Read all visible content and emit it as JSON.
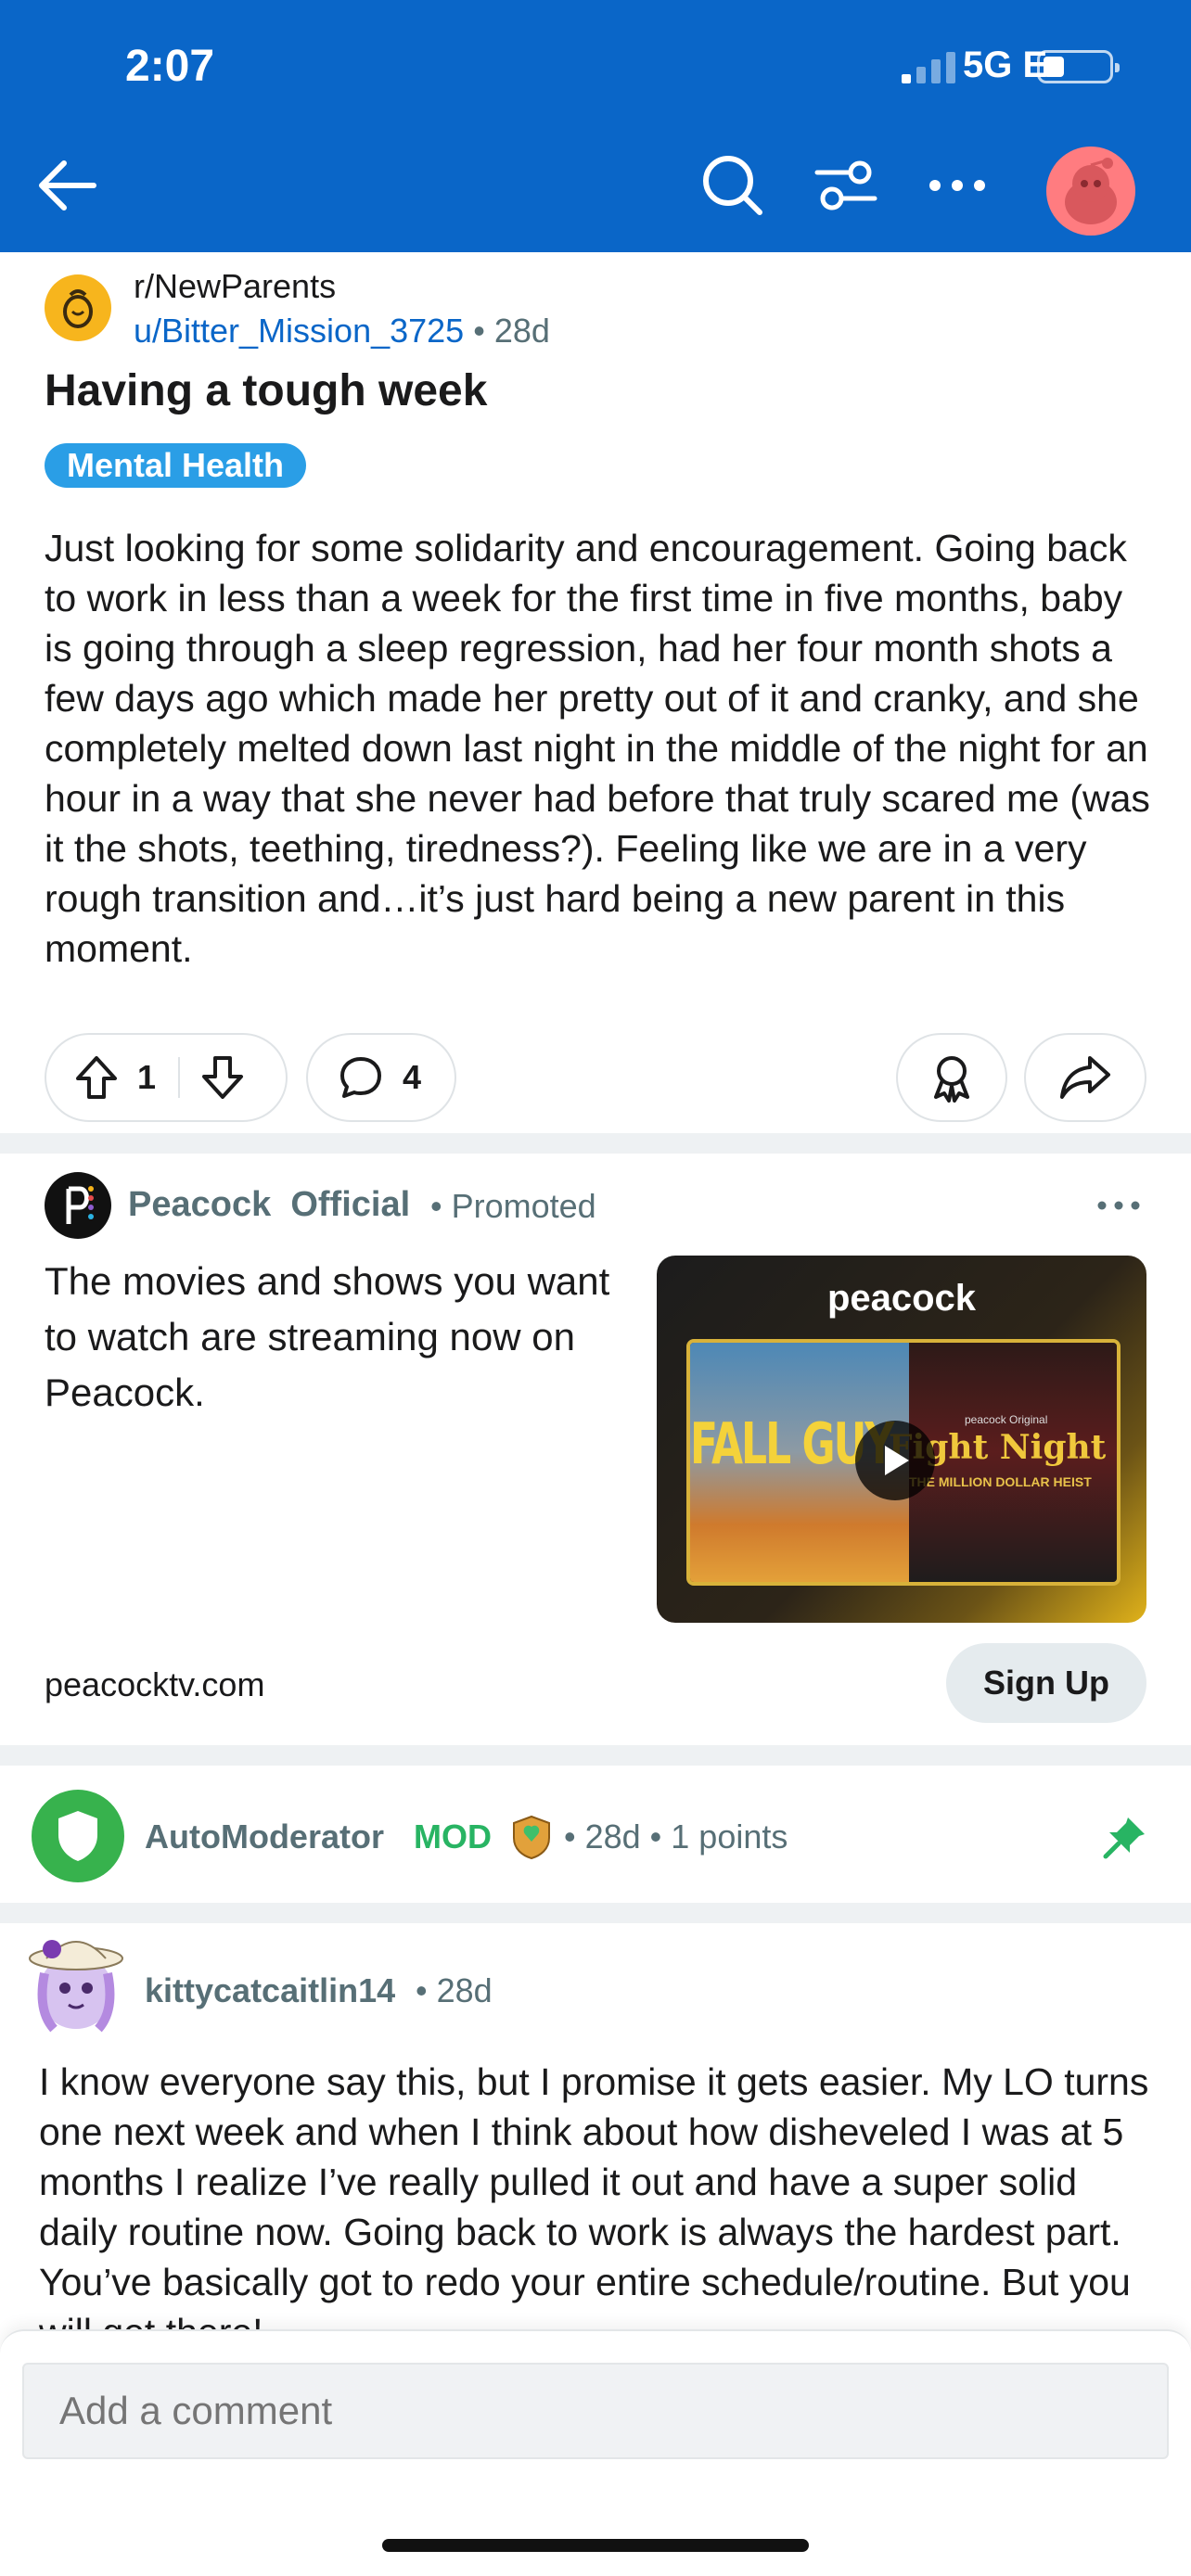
{
  "status_bar": {
    "time": "2:07",
    "network": "5G E"
  },
  "post": {
    "subreddit": "r/NewParents",
    "author": "u/Bitter_Mission_3725",
    "age": "28d",
    "title": "Having a tough week",
    "flair": "Mental Health",
    "body": "Just looking for some solidarity and encouragement. Going back to work in less than a week for the first time in five months, baby is going through a sleep regression, had her four month shots a few days ago which made her pretty out of it and cranky, and she completely melted down last night in the middle of the night for an hour in a way that she never had before that truly scared me (was it the shots, teething, tiredness?). Feeling like we are in a very rough transition and…it’s just hard being a new parent in this moment.",
    "upvotes": "1",
    "comments": "4"
  },
  "ad": {
    "advertiser": "Peacock  Official",
    "promoted": "• Promoted",
    "text": "The movies and shows you want to watch are streaming now on Peacock.",
    "media_logo": "peacock",
    "poster_left_title": "FALL GUY",
    "poster_right_small": "peacock Original",
    "poster_right_title": "Fight Night",
    "poster_right_sub": "THE MILLION DOLLAR HEIST",
    "domain": "peacocktv.com",
    "cta": "Sign Up"
  },
  "mod_comment": {
    "author": "AutoModerator",
    "badge": "MOD",
    "meta": "• 28d • 1 points"
  },
  "comment": {
    "author": "kittycatcaitlin14",
    "age": "• 28d",
    "body": "I know everyone say this, but I promise it gets easier. My LO turns one next week and when I think about how disheveled I was at 5 months I realize I’ve really pulled it out and have a super solid daily routine now. Going back to work is always the hardest part. You’ve basically got to redo your entire schedule/routine. But you will get there!"
  },
  "composer": {
    "placeholder": "Add a comment"
  },
  "colors": {
    "header": "#0a66c8",
    "flair": "#2a9ee6",
    "mod_green": "#28b463",
    "link": "#0a66c8"
  },
  "icons": [
    "back-arrow-icon",
    "search-icon",
    "filter-icon",
    "more-icon",
    "avatar",
    "upvote-icon",
    "downvote-icon",
    "comment-icon",
    "award-icon",
    "share-icon",
    "pin-icon",
    "shield-icon",
    "play-icon"
  ]
}
